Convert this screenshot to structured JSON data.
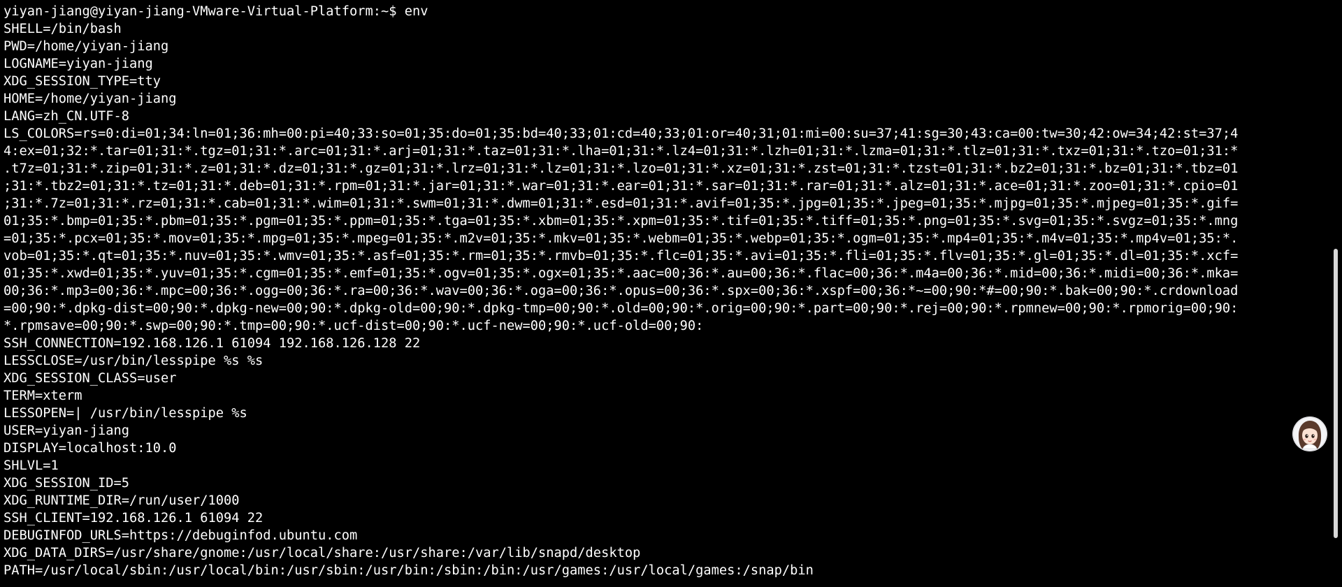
{
  "terminal": {
    "lines": [
      "yiyan-jiang@yiyan-jiang-VMware-Virtual-Platform:~$ env",
      "SHELL=/bin/bash",
      "PWD=/home/yiyan-jiang",
      "LOGNAME=yiyan-jiang",
      "XDG_SESSION_TYPE=tty",
      "HOME=/home/yiyan-jiang",
      "LANG=zh_CN.UTF-8",
      "LS_COLORS=rs=0:di=01;34:ln=01;36:mh=00:pi=40;33:so=01;35:do=01;35:bd=40;33;01:cd=40;33;01:or=40;31;01:mi=00:su=37;41:sg=30;43:ca=00:tw=30;42:ow=34;42:st=37;4",
      "4:ex=01;32:*.tar=01;31:*.tgz=01;31:*.arc=01;31:*.arj=01;31:*.taz=01;31:*.lha=01;31:*.lz4=01;31:*.lzh=01;31:*.lzma=01;31:*.tlz=01;31:*.txz=01;31:*.tzo=01;31:*",
      ".t7z=01;31:*.zip=01;31:*.z=01;31:*.dz=01;31:*.gz=01;31:*.lrz=01;31:*.lz=01;31:*.lzo=01;31:*.xz=01;31:*.zst=01;31:*.tzst=01;31:*.bz2=01;31:*.bz=01;31:*.tbz=01",
      ";31:*.tbz2=01;31:*.tz=01;31:*.deb=01;31:*.rpm=01;31:*.jar=01;31:*.war=01;31:*.ear=01;31:*.sar=01;31:*.rar=01;31:*.alz=01;31:*.ace=01;31:*.zoo=01;31:*.cpio=01",
      ";31:*.7z=01;31:*.rz=01;31:*.cab=01;31:*.wim=01;31:*.swm=01;31:*.dwm=01;31:*.esd=01;31:*.avif=01;35:*.jpg=01;35:*.jpeg=01;35:*.mjpg=01;35:*.mjpeg=01;35:*.gif=",
      "01;35:*.bmp=01;35:*.pbm=01;35:*.pgm=01;35:*.ppm=01;35:*.tga=01;35:*.xbm=01;35:*.xpm=01;35:*.tif=01;35:*.tiff=01;35:*.png=01;35:*.svg=01;35:*.svgz=01;35:*.mng",
      "=01;35:*.pcx=01;35:*.mov=01;35:*.mpg=01;35:*.mpeg=01;35:*.m2v=01;35:*.mkv=01;35:*.webm=01;35:*.webp=01;35:*.ogm=01;35:*.mp4=01;35:*.m4v=01;35:*.mp4v=01;35:*.",
      "vob=01;35:*.qt=01;35:*.nuv=01;35:*.wmv=01;35:*.asf=01;35:*.rm=01;35:*.rmvb=01;35:*.flc=01;35:*.avi=01;35:*.fli=01;35:*.flv=01;35:*.gl=01;35:*.dl=01;35:*.xcf=",
      "01;35:*.xwd=01;35:*.yuv=01;35:*.cgm=01;35:*.emf=01;35:*.ogv=01;35:*.ogx=01;35:*.aac=00;36:*.au=00;36:*.flac=00;36:*.m4a=00;36:*.mid=00;36:*.midi=00;36:*.mka=",
      "00;36:*.mp3=00;36:*.mpc=00;36:*.ogg=00;36:*.ra=00;36:*.wav=00;36:*.oga=00;36:*.opus=00;36:*.spx=00;36:*.xspf=00;36:*~=00;90:*#=00;90:*.bak=00;90:*.crdownload",
      "=00;90:*.dpkg-dist=00;90:*.dpkg-new=00;90:*.dpkg-old=00;90:*.dpkg-tmp=00;90:*.old=00;90:*.orig=00;90:*.part=00;90:*.rej=00;90:*.rpmnew=00;90:*.rpmorig=00;90:",
      "*.rpmsave=00;90:*.swp=00;90:*.tmp=00;90:*.ucf-dist=00;90:*.ucf-new=00;90:*.ucf-old=00;90:",
      "SSH_CONNECTION=192.168.126.1 61094 192.168.126.128 22",
      "LESSCLOSE=/usr/bin/lesspipe %s %s",
      "XDG_SESSION_CLASS=user",
      "TERM=xterm",
      "LESSOPEN=| /usr/bin/lesspipe %s",
      "USER=yiyan-jiang",
      "DISPLAY=localhost:10.0",
      "SHLVL=1",
      "XDG_SESSION_ID=5",
      "XDG_RUNTIME_DIR=/run/user/1000",
      "SSH_CLIENT=192.168.126.1 61094 22",
      "DEBUGINFOD_URLS=https://debuginfod.ubuntu.com",
      "XDG_DATA_DIRS=/usr/share/gnome:/usr/local/share:/usr/share:/var/lib/snapd/desktop",
      "PATH=/usr/local/sbin:/usr/local/bin:/usr/sbin:/usr/bin:/sbin:/bin:/usr/games:/usr/local/games:/snap/bin"
    ]
  },
  "colors": {
    "background": "#000000",
    "foreground": "#ffffff",
    "scrollbar_thumb": "#d8d8d8"
  },
  "icons": {
    "avatar": "assistant-avatar-icon"
  }
}
